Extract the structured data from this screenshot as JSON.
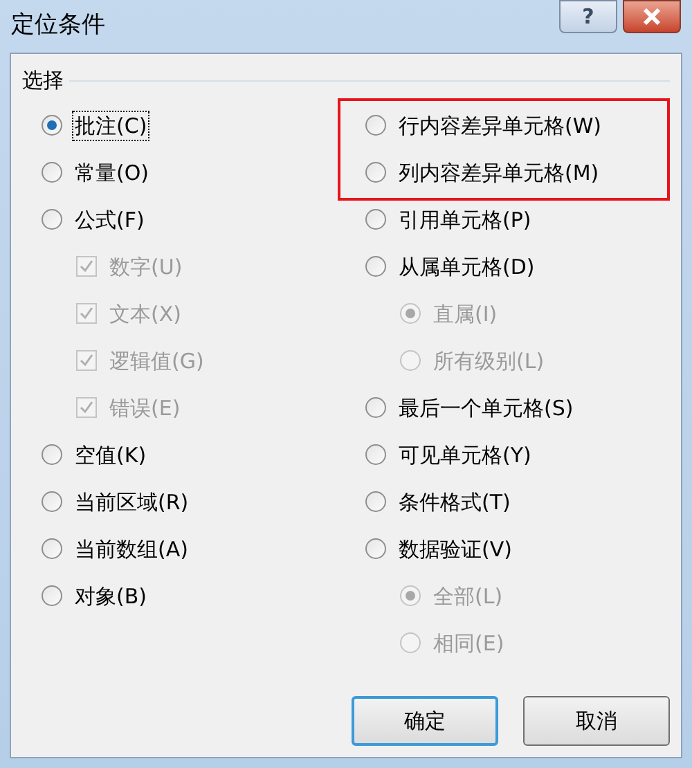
{
  "window": {
    "title": "定位条件"
  },
  "help_button": {
    "label": "?"
  },
  "group": {
    "label": "选择"
  },
  "left": [
    {
      "label": "批注(C)",
      "kind": "radio",
      "selected": true,
      "focused": true,
      "disabled": false
    },
    {
      "label": "常量(O)",
      "kind": "radio",
      "selected": false,
      "focused": false,
      "disabled": false
    },
    {
      "label": "公式(F)",
      "kind": "radio",
      "selected": false,
      "focused": false,
      "disabled": false,
      "children": [
        {
          "label": "数字(U)",
          "kind": "checkbox",
          "checked": true,
          "disabled": true
        },
        {
          "label": "文本(X)",
          "kind": "checkbox",
          "checked": true,
          "disabled": true
        },
        {
          "label": "逻辑值(G)",
          "kind": "checkbox",
          "checked": true,
          "disabled": true
        },
        {
          "label": "错误(E)",
          "kind": "checkbox",
          "checked": true,
          "disabled": true
        }
      ]
    },
    {
      "label": "空值(K)",
      "kind": "radio",
      "selected": false,
      "focused": false,
      "disabled": false
    },
    {
      "label": "当前区域(R)",
      "kind": "radio",
      "selected": false,
      "focused": false,
      "disabled": false
    },
    {
      "label": "当前数组(A)",
      "kind": "radio",
      "selected": false,
      "focused": false,
      "disabled": false
    },
    {
      "label": "对象(B)",
      "kind": "radio",
      "selected": false,
      "focused": false,
      "disabled": false
    }
  ],
  "right": [
    {
      "label": "行内容差异单元格(W)",
      "kind": "radio",
      "selected": false,
      "focused": false,
      "disabled": false,
      "highlighted": true
    },
    {
      "label": "列内容差异单元格(M)",
      "kind": "radio",
      "selected": false,
      "focused": false,
      "disabled": false,
      "highlighted": true
    },
    {
      "label": "引用单元格(P)",
      "kind": "radio",
      "selected": false,
      "focused": false,
      "disabled": false,
      "highlighted": false
    },
    {
      "label": "从属单元格(D)",
      "kind": "radio",
      "selected": false,
      "focused": false,
      "disabled": false,
      "highlighted": false,
      "children": [
        {
          "label": "直属(I)",
          "kind": "radio",
          "selected": true,
          "disabled": true
        },
        {
          "label": "所有级别(L)",
          "kind": "radio",
          "selected": false,
          "disabled": true
        }
      ]
    },
    {
      "label": "最后一个单元格(S)",
      "kind": "radio",
      "selected": false,
      "focused": false,
      "disabled": false,
      "highlighted": false
    },
    {
      "label": "可见单元格(Y)",
      "kind": "radio",
      "selected": false,
      "focused": false,
      "disabled": false,
      "highlighted": false
    },
    {
      "label": "条件格式(T)",
      "kind": "radio",
      "selected": false,
      "focused": false,
      "disabled": false,
      "highlighted": false
    },
    {
      "label": "数据验证(V)",
      "kind": "radio",
      "selected": false,
      "focused": false,
      "disabled": false,
      "highlighted": false,
      "children": [
        {
          "label": "全部(L)",
          "kind": "radio",
          "selected": true,
          "disabled": true
        },
        {
          "label": "相同(E)",
          "kind": "radio",
          "selected": false,
          "disabled": true
        }
      ]
    }
  ],
  "buttons": [
    {
      "label": "确定",
      "default": true
    },
    {
      "label": "取消",
      "default": false
    }
  ]
}
